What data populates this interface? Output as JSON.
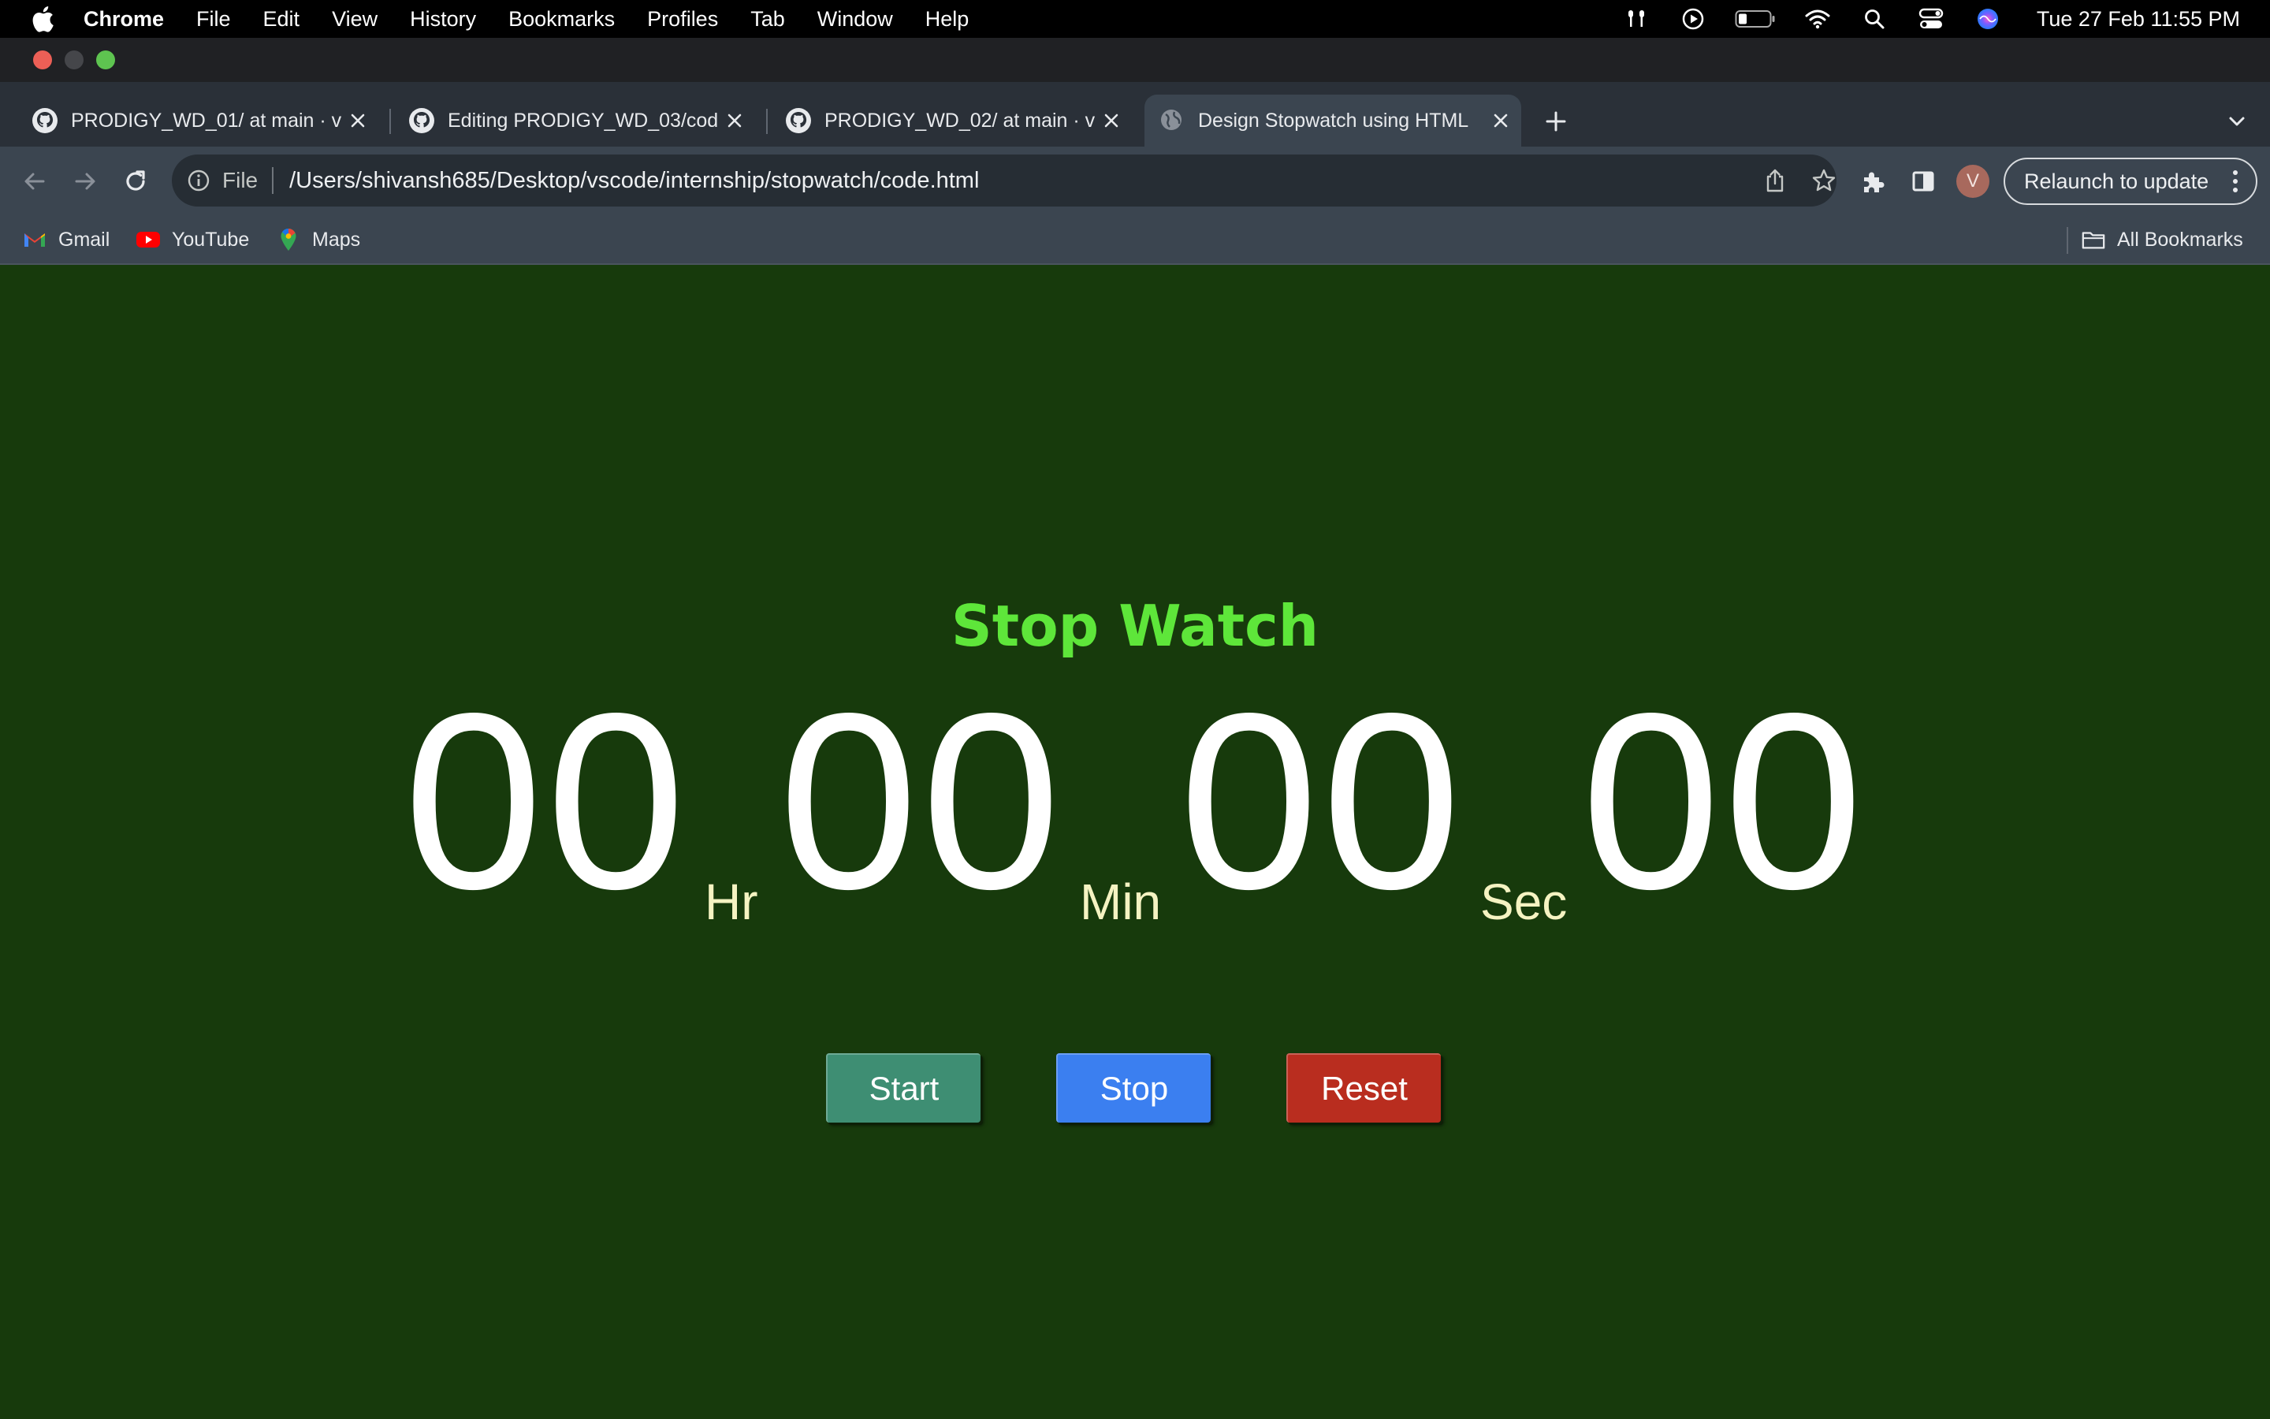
{
  "menubar": {
    "app_name": "Chrome",
    "items": [
      "File",
      "Edit",
      "View",
      "History",
      "Bookmarks",
      "Profiles",
      "Tab",
      "Window",
      "Help"
    ],
    "clock": "Tue 27 Feb  11:55 PM",
    "status_icons": [
      "airpods-icon",
      "play-icon",
      "battery-icon",
      "wifi-icon",
      "spotlight-icon",
      "control-center-icon",
      "siri-icon"
    ]
  },
  "browser": {
    "tabs": [
      {
        "title": "PRODIGY_WD_01/ at main · va",
        "icon": "github-icon"
      },
      {
        "title": "Editing PRODIGY_WD_03/code",
        "icon": "github-icon"
      },
      {
        "title": "PRODIGY_WD_02/ at main · va",
        "icon": "github-icon"
      },
      {
        "title": "Design Stopwatch using HTML",
        "icon": "globe-icon",
        "active": true
      }
    ],
    "omnibox": {
      "scheme_label": "File",
      "url": "/Users/shivansh685/Desktop/vscode/internship/stopwatch/code.html"
    },
    "avatar_letter": "V",
    "relaunch_label": "Relaunch to update",
    "bookmarks": [
      {
        "label": "Gmail",
        "icon": "gmail-icon"
      },
      {
        "label": "YouTube",
        "icon": "youtube-icon"
      },
      {
        "label": "Maps",
        "icon": "maps-icon"
      }
    ],
    "all_bookmarks_label": "All Bookmarks"
  },
  "stopwatch": {
    "title": "Stop Watch",
    "hours": "00",
    "hours_unit": "Hr",
    "minutes": "00",
    "minutes_unit": "Min",
    "seconds": "00",
    "seconds_unit": "Sec",
    "centiseconds": "00",
    "buttons": {
      "start": "Start",
      "stop": "Stop",
      "reset": "Reset"
    }
  },
  "colors": {
    "page_background": "#173a0c",
    "title_color": "#5ee63a",
    "start_button": "#3e8e73",
    "stop_button": "#3b7ff0",
    "reset_button": "#b92d1f"
  }
}
